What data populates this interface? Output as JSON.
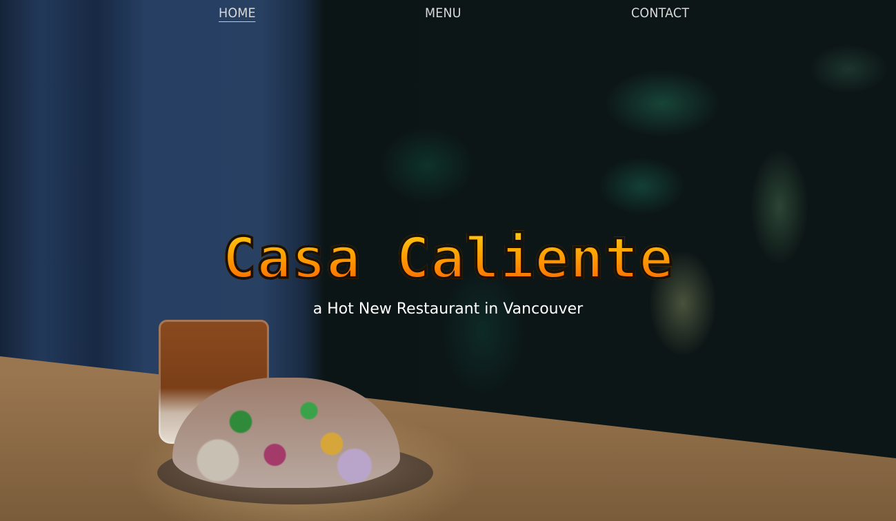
{
  "nav": {
    "items": [
      {
        "label": "HOME",
        "active": true
      },
      {
        "label": "MENU",
        "active": false
      },
      {
        "label": "CONTACT",
        "active": false
      }
    ]
  },
  "hero": {
    "title": "Casa Caliente",
    "subtitle": "a Hot New Restaurant in Vancouver"
  },
  "colors": {
    "title_top": "#ffd21a",
    "title_bottom": "#ff5a00",
    "nav_text": "#d8d8d8"
  }
}
